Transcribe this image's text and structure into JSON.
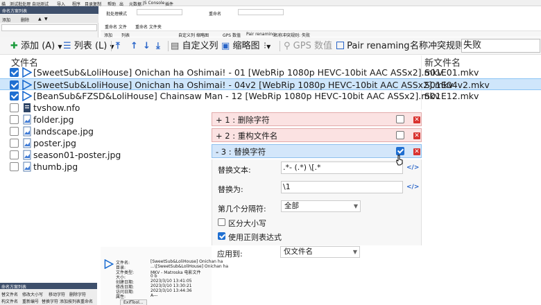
{
  "thumb": {
    "menubar": [
      "描",
      "测试批处理",
      "自动测试",
      "导入",
      "程序",
      "目录复制",
      "帮助",
      "出",
      "元数据",
      "JS Console",
      "插件"
    ],
    "leftpanel_title": "命名方案列表",
    "leftpanel_row": [
      "添加",
      "删除",
      "▲",
      "▼"
    ],
    "form_label_1": "批处理模式",
    "form_value_2": "重命名",
    "tabs": [
      "重命名 文件",
      "重命名 文件夹"
    ],
    "toolbar": [
      "添加",
      "列表",
      "自定义列",
      "缩略图",
      "GPS 数值",
      "Pair renaming",
      "名称冲突规则:",
      "失败"
    ]
  },
  "toolbar": {
    "add_label": "添加",
    "add_key": "(A)",
    "list_label": "列表",
    "list_key": "(L)",
    "custom_cols": "自定义列",
    "thumbnails": "缩略图",
    "gps": "GPS 数值",
    "pair": "Pair renaming",
    "conflict_label": "名称冲突规则:",
    "conflict_value": "失败"
  },
  "list": {
    "col_filename": "文件名",
    "col_newname": "新文件名",
    "rows": [
      {
        "name": "[SweetSub&LoliHouse] Onichan ha Oshimai! - 01 [WebRip 1080p HEVC-10bit AAC ASSx2].mkv",
        "new": "S01E01.mkv",
        "checked": true,
        "type": "video"
      },
      {
        "name": "[SweetSub&LoliHouse] Onichan ha Oshimai! - 04v2 [WebRip 1080p HEVC-10bit AAC ASSx2].mkv",
        "new": "S01E04v2.mkv",
        "checked": true,
        "type": "video"
      },
      {
        "name": "[BeanSub&FZSD&LoliHouse] Chainsaw Man - 12 [WebRip 1080p HEVC-10bit AAC ASSx2].mkv",
        "new": "S01E12.mkv",
        "checked": true,
        "type": "video"
      },
      {
        "name": "tvshow.nfo",
        "new": "",
        "checked": false,
        "type": "doc"
      },
      {
        "name": "folder.jpg",
        "new": "",
        "checked": false,
        "type": "image"
      },
      {
        "name": "landscape.jpg",
        "new": "",
        "checked": false,
        "type": "image"
      },
      {
        "name": "poster.jpg",
        "new": "",
        "checked": false,
        "type": "image"
      },
      {
        "name": "season01-poster.jpg",
        "new": "",
        "checked": false,
        "type": "image"
      },
      {
        "name": "thumb.jpg",
        "new": "",
        "checked": false,
        "type": "image"
      }
    ]
  },
  "rules": [
    {
      "title": "+ 1 : 删除字符",
      "enabled": false,
      "expanded": false
    },
    {
      "title": "+ 2 : 重构文件名",
      "enabled": false,
      "expanded": false
    },
    {
      "title": "- 3 : 替换字符",
      "enabled": true,
      "expanded": true
    }
  ],
  "rule3": {
    "replace_text_label": "替换文本:",
    "replace_text_value": ".*- (.*) \\[.*",
    "replace_with_label": "替换为:",
    "replace_with_value": "\\1",
    "nth_sep_label": "第几个分隔符:",
    "nth_sep_value": "全部",
    "case_label": "区分大小写",
    "case_checked": false,
    "regex_label": "使用正则表达式",
    "regex_checked": true,
    "apply_label": "应用到:",
    "apply_value": "仅文件名",
    "code_icon": "</>"
  },
  "bottom": {
    "panel_title": "命名方案列表",
    "actions": [
      "替文件名",
      "修改大小写",
      "移动字符",
      "删除字符",
      "构文件名",
      "重新编号",
      "替换字符",
      "添加",
      "按列表重命名"
    ],
    "info_labels": [
      "文件名:",
      "目录:",
      "文件类型:",
      "大小:",
      "创建日期:",
      "修改日期:",
      "访问日期:",
      "属性:"
    ],
    "info_values": [
      "[SweetSub&LoliHouse] Onichan ha",
      "...\\[SweetSub&LoliHouse] Onichan ha",
      "MKV - Matroska 电影文件",
      "0 b",
      "2023/3/10 13:41:05",
      "2023/3/10 13:30:21",
      "2023/3/10 13:44:36",
      "A---"
    ],
    "exif_button": "ExifTool..."
  },
  "colors": {
    "accent_blue": "#1f6fd1",
    "green": "#1c9b3c",
    "selected_row": "#cfe6fb",
    "rule_collapsed_bg": "#fbe2e2",
    "rule_expanded_bg": "#d3e6fa",
    "delete_red": "#d9322f"
  }
}
